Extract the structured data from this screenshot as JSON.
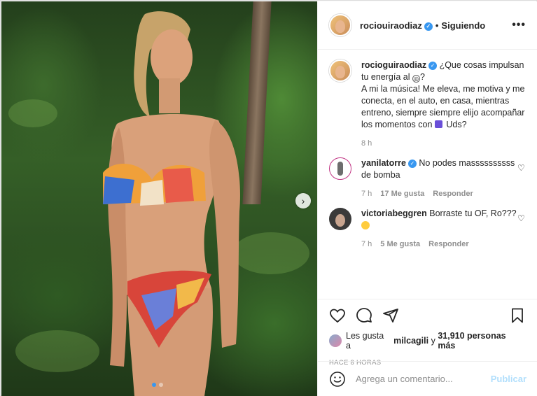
{
  "post": {
    "username": "rociouiraodiaz",
    "follow_status": "Siguiendo",
    "separator": "•",
    "more_icon": "more-horizontal-icon"
  },
  "caption": {
    "username": "rocioguiraodiaz",
    "line1": "¿Que cosas impulsan tu energía al",
    "line1_end": "?",
    "body": "A mi la música! Me eleva, me motiva y me conecta, en el auto, en casa, mientras entreno, siempre siempre elijo acompañar los momentos con",
    "body_end": "Uds?",
    "time": "8 h"
  },
  "comments": [
    {
      "username": "yanilatorre",
      "text": "No podes massssssssss de bomba",
      "time": "7 h",
      "likes": "17 Me gusta",
      "reply": "Responder"
    },
    {
      "username": "victoriabeggren",
      "text": "Borraste tu OF, Ro???",
      "time": "7 h",
      "likes": "5 Me gusta",
      "reply": "Responder"
    }
  ],
  "likes_line": {
    "prefix": "Les gusta a",
    "user": "milcagili",
    "middle": "y",
    "count": "31,910 personas más"
  },
  "posted_time": "HACE 8 HORAS",
  "comment_box": {
    "placeholder": "Agrega un comentario...",
    "publish_label": "Publicar"
  },
  "colors": {
    "verified": "#3897f0",
    "publish_disabled": "#b2dffc",
    "secondary_text": "#8e8e8e"
  }
}
